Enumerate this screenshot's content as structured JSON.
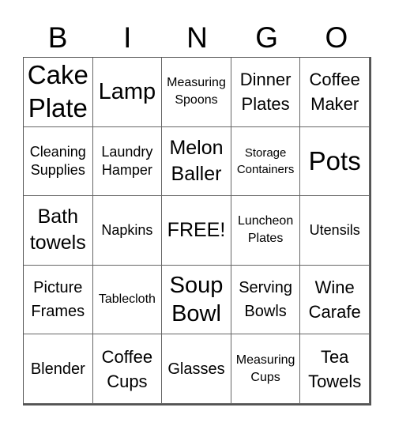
{
  "header": {
    "letters": [
      "B",
      "I",
      "N",
      "G",
      "O"
    ]
  },
  "card": {
    "rows": [
      [
        "Cake Plate",
        "Lamp",
        "Measuring Spoons",
        "Dinner Plates",
        "Coffee Maker"
      ],
      [
        "Cleaning Supplies",
        "Laundry Hamper",
        "Melon Baller",
        "Storage Containers",
        "Pots"
      ],
      [
        "Bath towels",
        "Napkins",
        "FREE!",
        "Luncheon Plates",
        "Utensils"
      ],
      [
        "Picture Frames",
        "Tablecloth",
        "Soup Bowl",
        "Serving Bowls",
        "Wine Carafe"
      ],
      [
        "Blender",
        "Coffee Cups",
        "Glasses",
        "Measuring Cups",
        "Tea Towels"
      ]
    ],
    "free_space": "FREE!"
  },
  "colors": {
    "background": "#ffffff",
    "text": "#000000",
    "grid_line": "#555555"
  }
}
